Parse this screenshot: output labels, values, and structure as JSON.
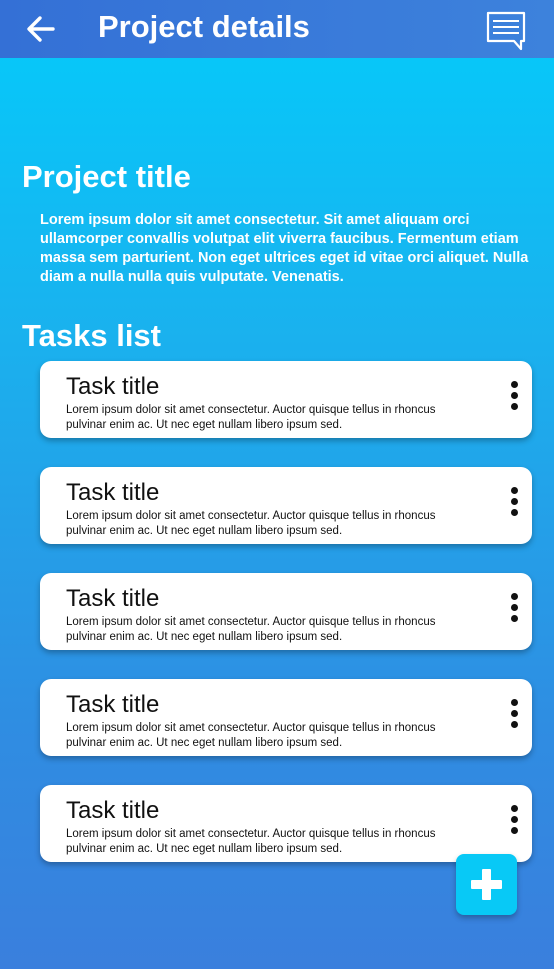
{
  "header": {
    "title": "Project details",
    "back_icon": "arrow-left-icon",
    "comment_icon": "message-icon"
  },
  "project": {
    "title": "Project title",
    "description": "Lorem ipsum dolor sit amet consectetur. Sit amet aliquam orci ullamcorper convallis volutpat elit viverra faucibus. Fermentum etiam massa sem parturient. Non eget ultrices eget id vitae orci aliquet. Nulla diam a nulla nulla quis vulputate. Venenatis."
  },
  "tasks": {
    "heading": "Tasks list",
    "items": [
      {
        "title": "Task title",
        "description": "Lorem ipsum dolor sit amet consectetur. Auctor quisque tellus in rhoncus pulvinar enim ac. Ut nec eget nullam libero ipsum sed."
      },
      {
        "title": "Task title",
        "description": "Lorem ipsum dolor sit amet consectetur. Auctor quisque tellus in rhoncus pulvinar enim ac. Ut nec eget nullam libero ipsum sed."
      },
      {
        "title": "Task title",
        "description": "Lorem ipsum dolor sit amet consectetur. Auctor quisque tellus in rhoncus pulvinar enim ac. Ut nec eget nullam libero ipsum sed."
      },
      {
        "title": "Task title",
        "description": "Lorem ipsum dolor sit amet consectetur. Auctor quisque tellus in rhoncus pulvinar enim ac. Ut nec eget nullam libero ipsum sed."
      },
      {
        "title": "Task title",
        "description": "Lorem ipsum dolor sit amet consectetur. Auctor quisque tellus in rhoncus pulvinar enim ac. Ut nec eget nullam libero ipsum sed."
      }
    ]
  },
  "fab": {
    "icon": "plus-icon"
  },
  "colors": {
    "header": "#3470d6",
    "accent": "#08c9f6",
    "gradient_top": "#04cbfb",
    "gradient_bottom": "#3a7fdd"
  }
}
